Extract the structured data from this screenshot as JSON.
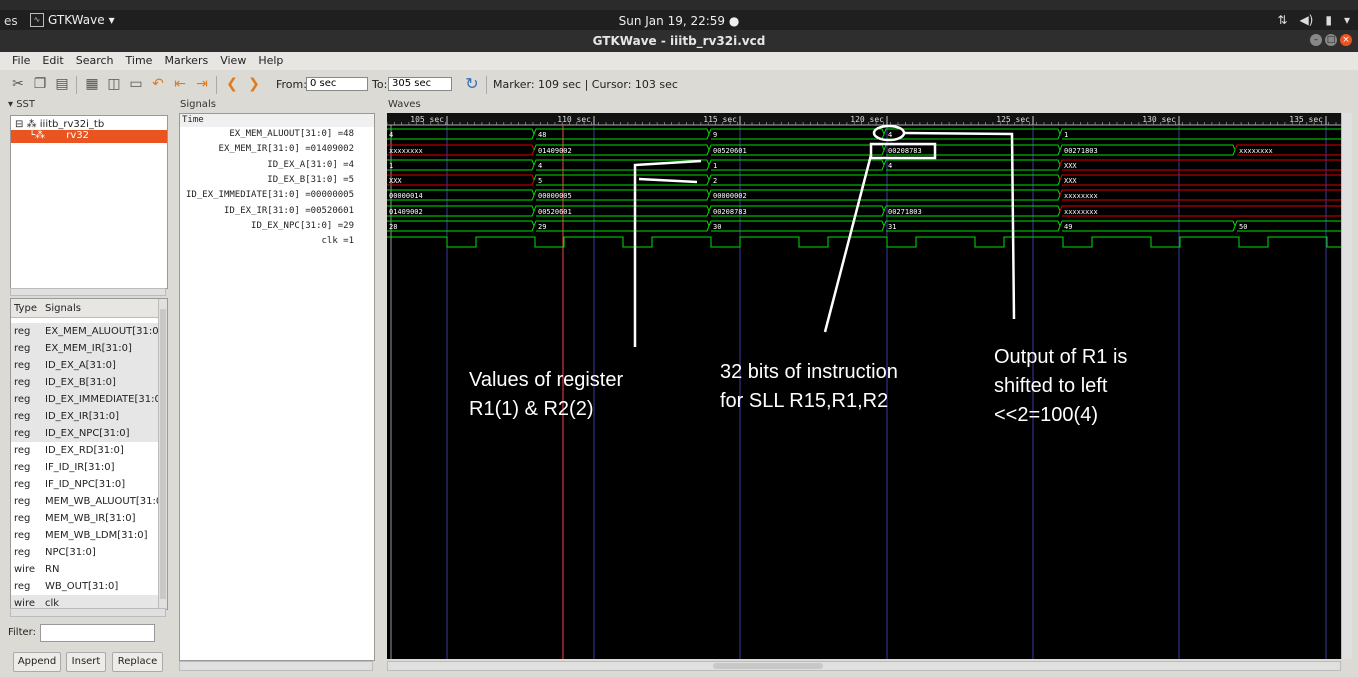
{
  "system": {
    "activities": "es",
    "app_menu": "GTKWave",
    "clock": "Sun Jan 19, 22:59 ●"
  },
  "window": {
    "title": "GTKWave - iiitb_rv32i.vcd"
  },
  "menu": [
    "File",
    "Edit",
    "Search",
    "Time",
    "Markers",
    "View",
    "Help"
  ],
  "toolbar": {
    "from_label": "From:",
    "from_value": "0 sec",
    "to_label": "To:",
    "to_value": "305 sec",
    "marker_text": "Marker: 109 sec  |  Cursor: 103 sec"
  },
  "sst": {
    "header": "SST",
    "root": "iiitb_rv32i_tb",
    "child": "rv32"
  },
  "signals_list": {
    "type_header": "Type",
    "signals_header": "Signals",
    "rows": [
      {
        "type": "reg",
        "name": "EX_MEM_ALUOUT[31:0]"
      },
      {
        "type": "reg",
        "name": "EX_MEM_IR[31:0]"
      },
      {
        "type": "reg",
        "name": "ID_EX_A[31:0]"
      },
      {
        "type": "reg",
        "name": "ID_EX_B[31:0]"
      },
      {
        "type": "reg",
        "name": "ID_EX_IMMEDIATE[31:0]"
      },
      {
        "type": "reg",
        "name": "ID_EX_IR[31:0]"
      },
      {
        "type": "reg",
        "name": "ID_EX_NPC[31:0]"
      },
      {
        "type": "reg",
        "name": "ID_EX_RD[31:0]"
      },
      {
        "type": "reg",
        "name": "IF_ID_IR[31:0]"
      },
      {
        "type": "reg",
        "name": "IF_ID_NPC[31:0]"
      },
      {
        "type": "reg",
        "name": "MEM_WB_ALUOUT[31:0]"
      },
      {
        "type": "reg",
        "name": "MEM_WB_IR[31:0]"
      },
      {
        "type": "reg",
        "name": "MEM_WB_LDM[31:0]"
      },
      {
        "type": "reg",
        "name": "NPC[31:0]"
      },
      {
        "type": "wire",
        "name": "RN"
      },
      {
        "type": "reg",
        "name": "WB_OUT[31:0]"
      },
      {
        "type": "wire",
        "name": "clk"
      }
    ]
  },
  "filter": {
    "label": "Filter:",
    "value": ""
  },
  "buttons": {
    "append": "Append",
    "insert": "Insert",
    "replace": "Replace"
  },
  "signals_panel": {
    "header": "Signals",
    "time_label": "Time",
    "rows": [
      "EX_MEM_ALUOUT[31:0] =48",
      "EX_MEM_IR[31:0] =01409002",
      "ID_EX_A[31:0] =4",
      "ID_EX_B[31:0] =5",
      "ID_EX_IMMEDIATE[31:0] =00000005",
      "ID_EX_IR[31:0] =00520601",
      "ID_EX_NPC[31:0] =29",
      "clk =1"
    ]
  },
  "waves": {
    "header": "Waves",
    "time_ticks": [
      "105 sec",
      "110 sec",
      "115 sec",
      "120 sec",
      "125 sec",
      "130 sec",
      "135 sec"
    ],
    "tracks": [
      {
        "segments": [
          "4",
          "48",
          "9",
          "4",
          "1"
        ],
        "kinds": [
          "n",
          "n",
          "n",
          "n",
          "n"
        ]
      },
      {
        "segments": [
          "xxxxxxxx",
          "01409002",
          "00520601",
          "00208783",
          "00271803",
          "xxxxxxxx"
        ],
        "kinds": [
          "x",
          "n",
          "n",
          "n",
          "n",
          "x"
        ]
      },
      {
        "segments": [
          "1",
          "4",
          "1",
          "4",
          "XXX"
        ],
        "kinds": [
          "n",
          "n",
          "n",
          "n",
          "x"
        ]
      },
      {
        "segments": [
          "XXX",
          "5",
          "2",
          "XXX"
        ],
        "kinds": [
          "x",
          "n",
          "n",
          "x"
        ]
      },
      {
        "segments": [
          "00000014",
          "00000005",
          "00000002",
          "xxxxxxxx"
        ],
        "kinds": [
          "n",
          "n",
          "n",
          "x"
        ]
      },
      {
        "segments": [
          "01409002",
          "00520601",
          "00208783",
          "00271803",
          "xxxxxxxx"
        ],
        "kinds": [
          "n",
          "n",
          "n",
          "n",
          "x"
        ]
      },
      {
        "segments": [
          "28",
          "29",
          "30",
          "31",
          "49",
          "50"
        ],
        "kinds": [
          "n",
          "n",
          "n",
          "n",
          "n",
          "n"
        ]
      }
    ],
    "colors": {
      "normal": "#00e000",
      "unknown": "#e00000",
      "grid": "#3a3aa0",
      "marker": "#ff4040"
    }
  },
  "annotations": {
    "registers_line1": "Values of register",
    "registers_line2": "R1(1) & R2(2)",
    "instruction_line1": "32 bits of instruction",
    "instruction_line2": "for SLL R15,R1,R2",
    "output_line1": "Output of R1 is",
    "output_line2": "shifted to left",
    "output_line3": "<<2=100(4)"
  }
}
